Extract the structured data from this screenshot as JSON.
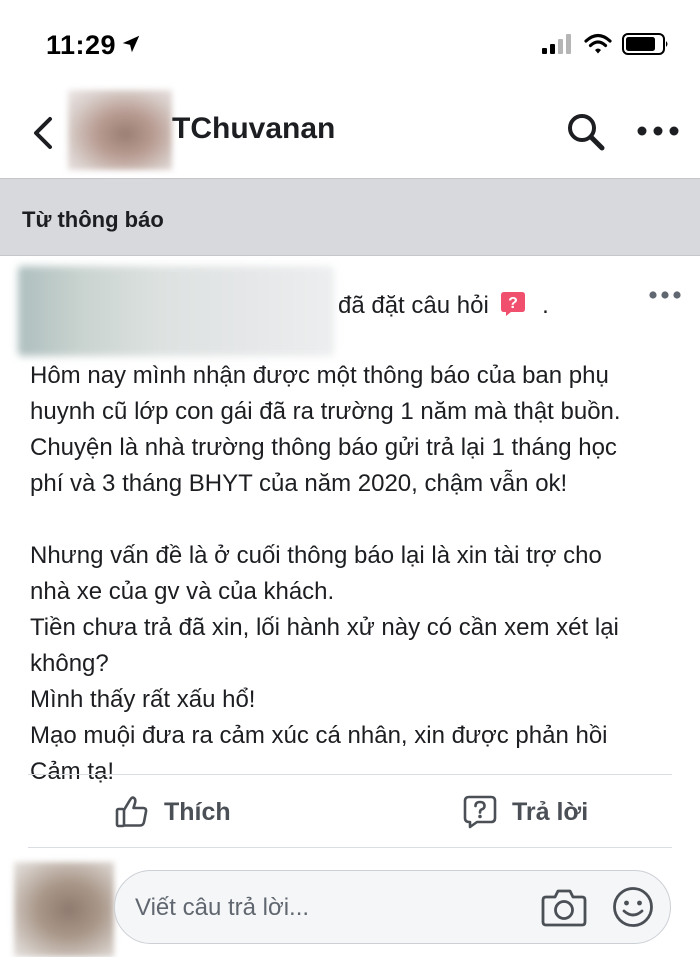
{
  "status_bar": {
    "time": "11:29",
    "location_icon": "location-arrow-icon",
    "signal_icon": "cellular-signal-icon",
    "wifi_icon": "wifi-icon",
    "battery_icon": "battery-icon"
  },
  "header": {
    "back_icon": "chevron-left-icon",
    "page_name": "TChuvanan",
    "search_icon": "search-icon",
    "more_icon": "more-horizontal-icon"
  },
  "section": {
    "label": "Từ thông báo"
  },
  "post": {
    "action_text": "đã đặt câu hỏi",
    "action_suffix": ".",
    "question_badge_icon": "question-badge-icon",
    "body_lines": [
      "Hôm nay mình nhận được một thông báo của ban phụ",
      "huynh cũ lớp con gái đã ra trường 1 năm mà thật buồn.",
      "Chuyện là nhà trường thông báo gửi trả lại 1 tháng học",
      "phí và 3 tháng BHYT của năm 2020, chậm vẫn ok!",
      "",
      "Nhưng vấn đề là ở cuối thông báo lại là xin tài trợ cho",
      "nhà xe của gv và của khách.",
      "Tiền chưa trả đã xin, lối hành xử này có cần xem xét lại",
      "không?",
      "Mình thấy rất xấu hổ!",
      "Mạo muội đưa ra cảm xúc cá nhân, xin được phản hồi",
      "Cảm tạ!"
    ]
  },
  "actions": {
    "like_label": "Thích",
    "like_icon": "thumbs-up-icon",
    "reply_label": "Trả lời",
    "reply_icon": "question-bubble-icon"
  },
  "composer": {
    "placeholder": "Viết câu trả lời...",
    "camera_icon": "camera-icon",
    "emoji_icon": "smiley-icon"
  },
  "colors": {
    "text": "#1c1e21",
    "secondary_text": "#4b4f56",
    "section_band": "#d7d9dd",
    "question_badge": "#f0506e",
    "divider": "#dadde1"
  }
}
